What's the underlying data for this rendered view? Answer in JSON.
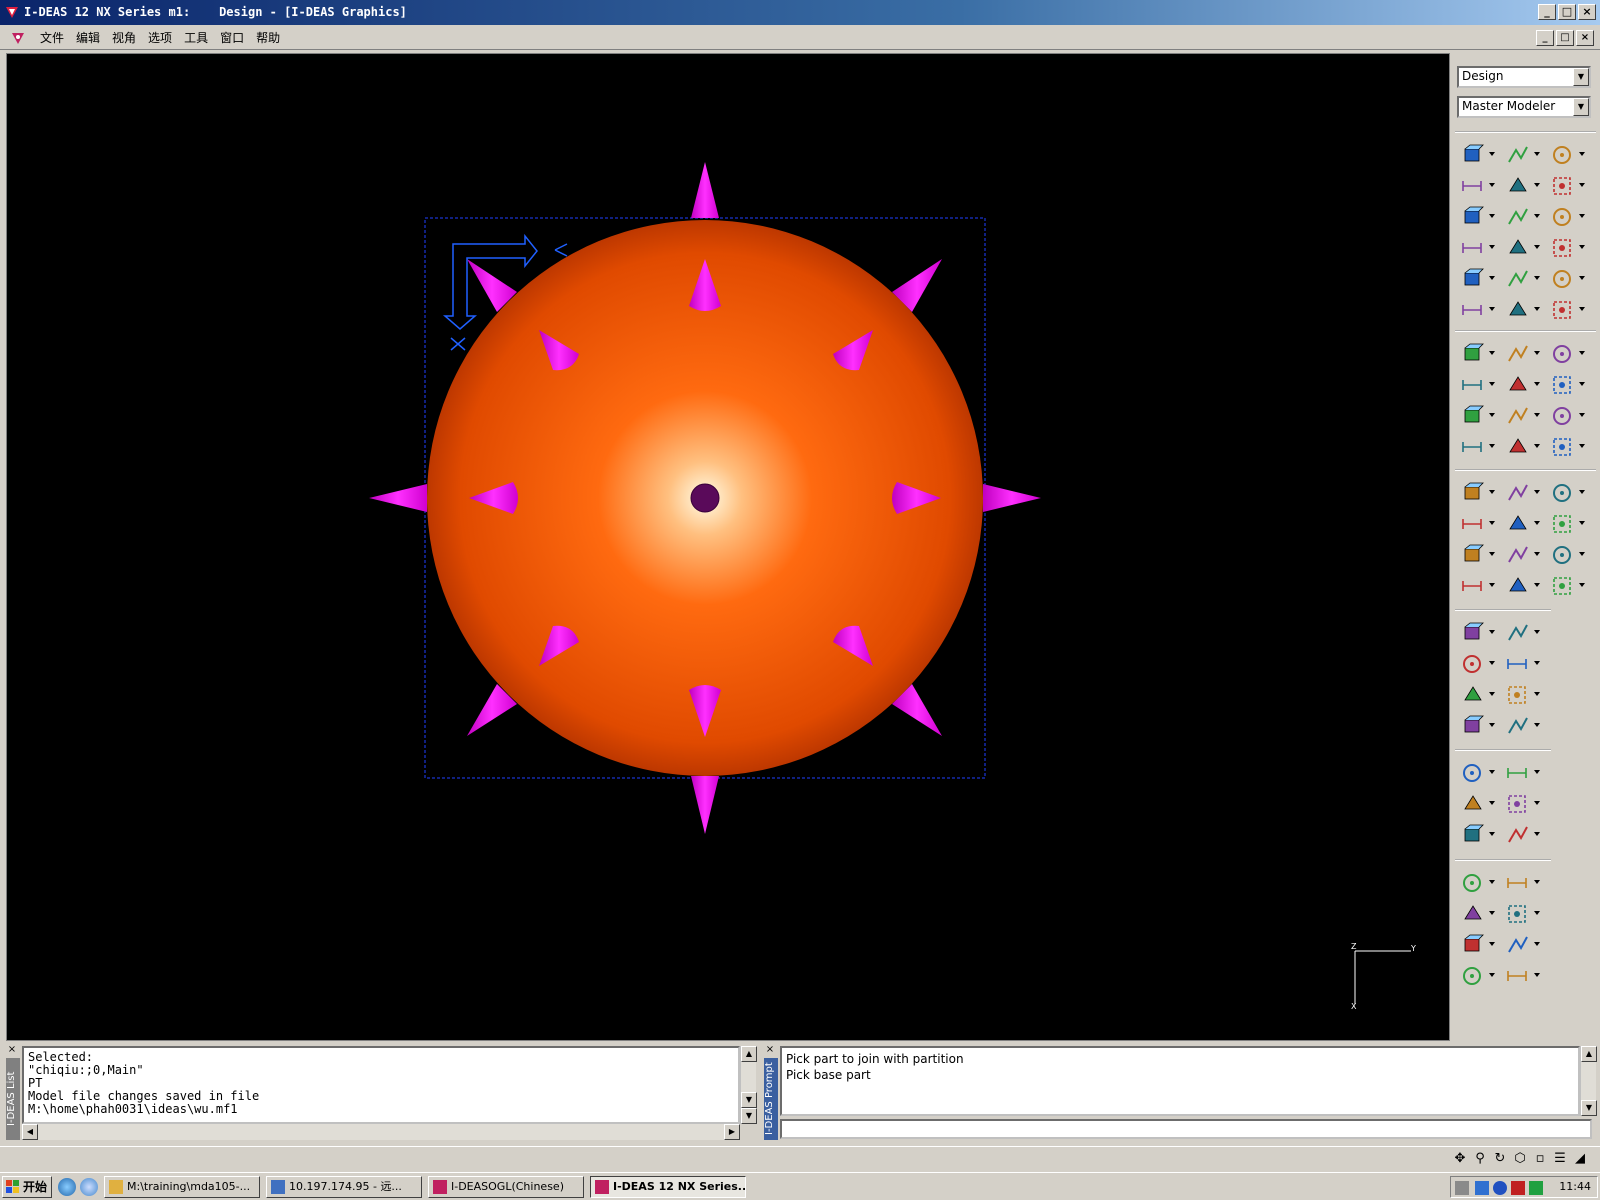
{
  "window": {
    "title": "I-DEAS 12 NX Series m1:    Design - [I-DEAS Graphics]",
    "min_label": "_",
    "max_label": "□",
    "close_label": "×"
  },
  "menu": {
    "items": [
      "文件",
      "编辑",
      "视角",
      "选项",
      "工具",
      "窗口",
      "帮助"
    ]
  },
  "right_panel": {
    "task_combo": "Design",
    "app_combo": "Master Modeler"
  },
  "viewport": {
    "triad": {
      "top_left": "Z",
      "top_right": "Y",
      "bottom": "X"
    },
    "sphere_color": "#ff5a00",
    "spike_color": "#ff00ff",
    "selection_color": "#2040ff"
  },
  "list_panel": {
    "side_label": "I-DEAS List",
    "lines": "Selected:\n\"chiqiu:;0,Main\"\nPT\nModel file changes saved in file\nM:\\home\\phah0031\\ideas\\wu.mf1"
  },
  "prompt_panel": {
    "side_label": "I-DEAS Prompt",
    "line1": "Pick part to join with partition",
    "line2": "Pick base part",
    "input_value": ""
  },
  "taskbar": {
    "start_label": "开始",
    "buttons": [
      "M:\\training\\mda105-...",
      "10.197.174.95 - 远...",
      "I-DEASOGL(Chinese)",
      "I-DEAS 12 NX Series..."
    ],
    "clock": "11:44"
  }
}
